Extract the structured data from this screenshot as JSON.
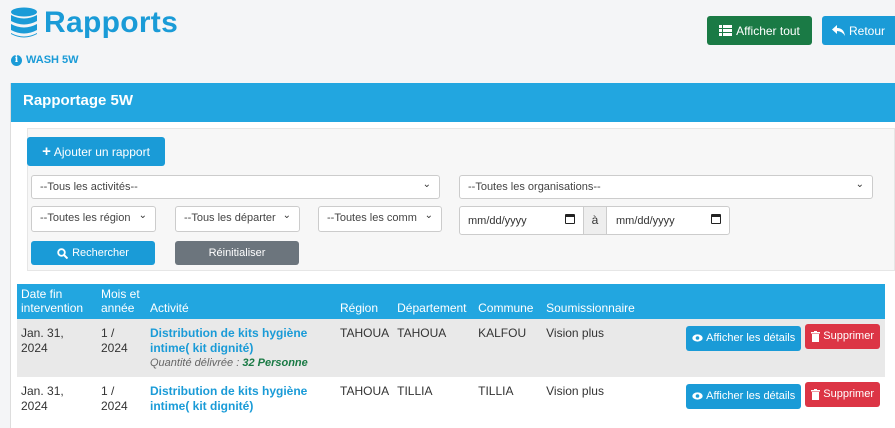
{
  "header": {
    "title": "Rapports",
    "subtitle": "WASH 5W",
    "show_all_label": "Afficher tout",
    "back_label": "Retour"
  },
  "card": {
    "title": "Rapportage 5W",
    "add_label": "Ajouter un rapport"
  },
  "filters": {
    "activities": "--Tous les activités--",
    "organisations": "--Toutes les organisations--",
    "regions": "--Toutes les région",
    "departments": "--Tous les départer",
    "communes": "--Toutes les comm",
    "date_from_placeholder": "mm/dd/yyyy",
    "date_sep": "à",
    "date_to_placeholder": "mm/dd/yyyy",
    "search_label": "Rechercher",
    "reset_label": "Réinitialiser"
  },
  "table": {
    "headers": {
      "end_date": "Date fin intervention",
      "month_year": "Mois et année",
      "activity": "Activité",
      "region": "Région",
      "department": "Département",
      "commune": "Commune",
      "bidder": "Soumissionnaire"
    },
    "rows": [
      {
        "end_date": "Jan. 31, 2024",
        "month_year": "1 / 2024",
        "activity": "Distribution de kits hygiène intime( kit dignité)",
        "quantity_label": "Quantité délivrée : ",
        "quantity_value": "32 Personne",
        "region": "TAHOUA",
        "department": "TAHOUA",
        "commune": "KALFOU",
        "bidder": "Vision plus",
        "details_label": "Afficher les détails",
        "delete_label": "Supprimer"
      },
      {
        "end_date": "Jan. 31, 2024",
        "month_year": "1 / 2024",
        "activity": "Distribution de kits hygiène intime( kit dignité)",
        "region": "TAHOUA",
        "department": "TILLIA",
        "commune": "TILLIA",
        "bidder": "Vision plus",
        "details_label": "Afficher les détails",
        "delete_label": "Supprimer"
      }
    ]
  },
  "colors": {
    "primary": "#1a9bd7",
    "header_bar": "#22a6e0",
    "success": "#1a7a45",
    "danger": "#dc3545",
    "secondary": "#6c757d"
  }
}
